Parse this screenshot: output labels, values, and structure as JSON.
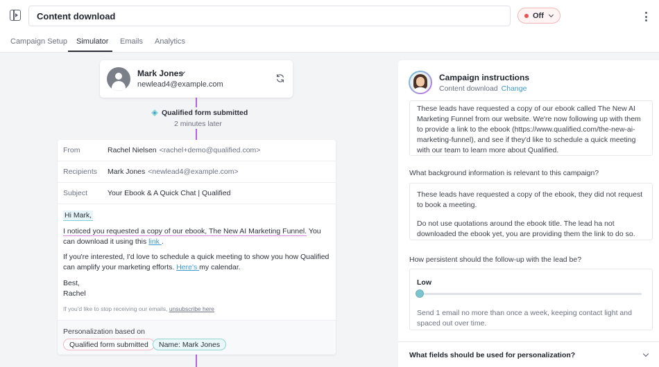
{
  "header": {
    "title_value": "Content download",
    "status_label": "Off"
  },
  "tabs": [
    {
      "label": "Campaign Setup"
    },
    {
      "label": "Simulator"
    },
    {
      "label": "Emails"
    },
    {
      "label": "Analytics"
    }
  ],
  "contact": {
    "name": "Mark Jones",
    "email": "newlead4@example.com"
  },
  "trigger": {
    "label": "Qualified form submitted",
    "time": "2 minutes later"
  },
  "email": {
    "from_label": "From",
    "from_name": "Rachel Nielsen",
    "from_address": "<rachel+demo@qualified.com>",
    "recipients_label": "Recipients",
    "recipients_name": "Mark Jones",
    "recipients_address": "<newlead4@example.com>",
    "subject_label": "Subject",
    "subject_value": "Your Ebook & A Quick Chat | Qualified",
    "greeting": "Hi Mark,",
    "p1_highlight": "I noticed you requested a copy of our ebook, The New AI Marketing Funnel.",
    "p1_rest": " You can download it using this ",
    "p1_link": "link ",
    "p1_end": ".",
    "p2_text": "If you're interested, I'd love to schedule a quick meeting to show you how Qualified can amplify your marketing efforts. ",
    "p2_link": "Here's ",
    "p2_end": "my calendar.",
    "signoff": "Best,",
    "signature": "Rachel",
    "footer_text": "If you'd like to stop receiving our emails, ",
    "footer_link": "unsubscribe here",
    "personalization_label": "Personalization based on",
    "chips": [
      {
        "label": "Qualified form submitted"
      },
      {
        "label": "Name: Mark Jones"
      }
    ]
  },
  "instructions": {
    "title": "Campaign instructions",
    "subtitle": "Content download",
    "change_label": "Change",
    "description": "These leads have requested a copy of our ebook called The New AI Marketing Funnel from our website. We're now following up with them to provide a link to the ebook (https://www.qualified.com/the-new-ai-marketing-funnel), and see if they'd like to schedule a quick meeting with our team to learn more about Qualified.",
    "background_question": "What background information is relevant to this campaign?",
    "background_p1": "These leads have requested a copy of the ebook, they did not request to book a meeting.",
    "background_p2": "Do not use quotations around the ebook title. The lead ha not downloaded the ebook yet, you are providing them the link to do so.",
    "persistence_question": "How persistent should the follow-up with the lead be?",
    "persistence_level": "Low",
    "persistence_value": 0,
    "persistence_description": "Send 1 email no more than once a week, keeping contact light and spaced out over time.",
    "fields_question": "What fields should be used for personalization?"
  },
  "colors": {
    "accent_teal": "#3c99c9",
    "connector_purple": "#b25ee8",
    "status_red": "#e65353"
  },
  "icons": [
    "sidebar-toggle-icon",
    "chevron-down-icon",
    "kebab-menu-icon",
    "user-avatar-icon",
    "refresh-icon",
    "form-trigger-icon"
  ]
}
